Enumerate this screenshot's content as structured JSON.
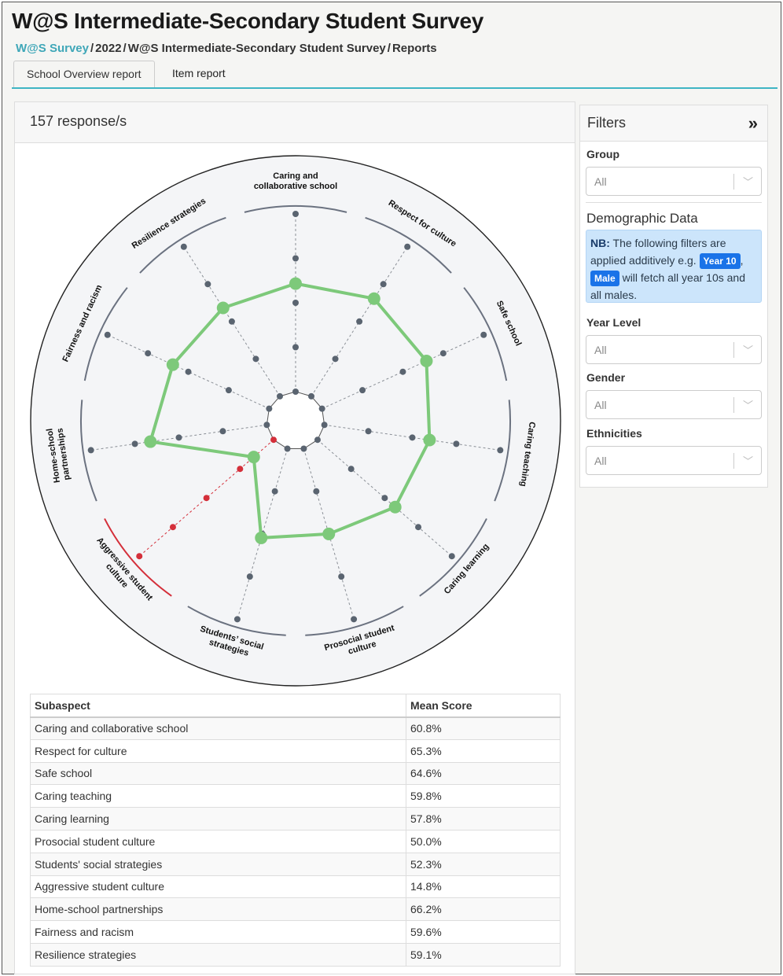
{
  "header": {
    "title": "W@S Intermediate-Secondary Student Survey",
    "breadcrumb": [
      "W@S Survey",
      "2022",
      "W@S Intermediate-Secondary Student Survey",
      "Reports"
    ],
    "separator": "/"
  },
  "tabs": [
    {
      "label": "School Overview report",
      "active": true
    },
    {
      "label": "Item report",
      "active": false
    }
  ],
  "main": {
    "responses": "157 response/s",
    "table": {
      "headers": [
        "Subaspect",
        "Mean Score"
      ],
      "rows": [
        [
          "Caring and collaborative school",
          "60.8%"
        ],
        [
          "Respect for culture",
          "65.3%"
        ],
        [
          "Safe school",
          "64.6%"
        ],
        [
          "Caring teaching",
          "59.8%"
        ],
        [
          "Caring learning",
          "57.8%"
        ],
        [
          "Prosocial student culture",
          "50.0%"
        ],
        [
          "Students' social strategies",
          "52.3%"
        ],
        [
          "Aggressive student culture",
          "14.8%"
        ],
        [
          "Home-school partnerships",
          "66.2%"
        ],
        [
          "Fairness and racism",
          "59.6%"
        ],
        [
          "Resilience strategies",
          "59.1%"
        ]
      ]
    }
  },
  "filters": {
    "title": "Filters",
    "expand_icon": "double-chevron-right-icon",
    "group": {
      "label": "Group",
      "value": "All"
    },
    "demographic_title": "Demographic Data",
    "nb": {
      "lead": "NB:",
      "text1": "The following filters are applied additively e.g.",
      "pill1": "Year 10",
      "comma": ",",
      "pill2": "Male",
      "text2": "will fetch all year 10s and all males."
    },
    "year_level": {
      "label": "Year Level",
      "value": "All"
    },
    "gender": {
      "label": "Gender",
      "value": "All"
    },
    "ethnicities": {
      "label": "Ethnicities",
      "value": "All"
    }
  },
  "chart_data": {
    "type": "radar",
    "categories": [
      "Caring and collaborative school",
      "Respect for culture",
      "Safe school",
      "Caring teaching",
      "Caring learning",
      "Prosocial student culture",
      "Students' social strategies",
      "Aggressive student culture",
      "Home-school partnerships",
      "Fairness and racism",
      "Resilience strategies"
    ],
    "values": [
      60.8,
      65.3,
      64.6,
      59.8,
      57.8,
      50.0,
      52.3,
      14.8,
      66.2,
      59.6,
      59.1
    ],
    "ylim": [
      0,
      100
    ],
    "highlight_category": "Aggressive student culture",
    "colors": {
      "series": "#7dc97a",
      "highlight": "#d42f3a",
      "ref": "#5a6470",
      "axis_line": "#6b7280",
      "disc": "#f4f5f7"
    }
  }
}
